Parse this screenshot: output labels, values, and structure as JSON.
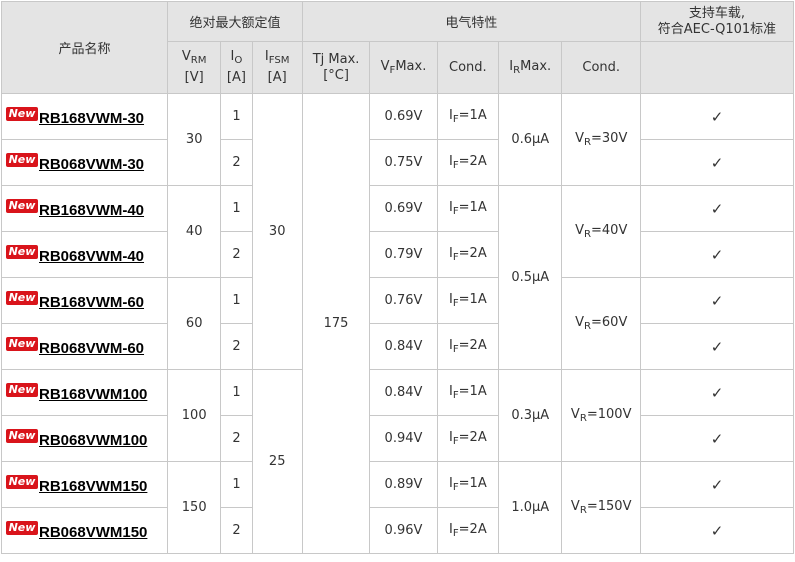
{
  "headers": {
    "product_name": "产品名称",
    "abs_max": "绝对最大额定值",
    "elec": "电气特性",
    "automotive_line1": "支持车载,",
    "automotive_line2": "符合AEC-Q101标准",
    "vrm_main": "V",
    "vrm_sub": "RM",
    "vrm_unit": "[V]",
    "io_main": "I",
    "io_sub": "O",
    "io_unit": "[A]",
    "ifsm_main": "I",
    "ifsm_sub": "FSM",
    "ifsm_unit": "[A]",
    "tj_main": "Tj Max.",
    "tj_unit": "[°C]",
    "vf_main": "V",
    "vf_sub": "F",
    "vf_rest": "Max.",
    "cond1": "Cond.",
    "ir_main": "I",
    "ir_sub": "R",
    "ir_rest": "Max.",
    "cond2": "Cond."
  },
  "badge": "New",
  "check_mark": "✓",
  "rows": [
    {
      "name": "RB168VWM-30",
      "io": "1",
      "vf": "0.69V",
      "cond_main": "I",
      "cond_sub": "F",
      "cond_rest": "=1A"
    },
    {
      "name": "RB068VWM-30",
      "io": "2",
      "vf": "0.75V",
      "cond_main": "I",
      "cond_sub": "F",
      "cond_rest": "=2A"
    },
    {
      "name": "RB168VWM-40",
      "io": "1",
      "vf": "0.69V",
      "cond_main": "I",
      "cond_sub": "F",
      "cond_rest": "=1A"
    },
    {
      "name": "RB068VWM-40",
      "io": "2",
      "vf": "0.79V",
      "cond_main": "I",
      "cond_sub": "F",
      "cond_rest": "=2A"
    },
    {
      "name": "RB168VWM-60",
      "io": "1",
      "vf": "0.76V",
      "cond_main": "I",
      "cond_sub": "F",
      "cond_rest": "=1A"
    },
    {
      "name": "RB068VWM-60",
      "io": "2",
      "vf": "0.84V",
      "cond_main": "I",
      "cond_sub": "F",
      "cond_rest": "=2A"
    },
    {
      "name": "RB168VWM100",
      "io": "1",
      "vf": "0.84V",
      "cond_main": "I",
      "cond_sub": "F",
      "cond_rest": "=1A"
    },
    {
      "name": "RB068VWM100",
      "io": "2",
      "vf": "0.94V",
      "cond_main": "I",
      "cond_sub": "F",
      "cond_rest": "=2A"
    },
    {
      "name": "RB168VWM150",
      "io": "1",
      "vf": "0.89V",
      "cond_main": "I",
      "cond_sub": "F",
      "cond_rest": "=1A"
    },
    {
      "name": "RB068VWM150",
      "io": "2",
      "vf": "0.96V",
      "cond_main": "I",
      "cond_sub": "F",
      "cond_rest": "=2A"
    }
  ],
  "vrm": [
    "30",
    "40",
    "60",
    "100",
    "150"
  ],
  "ifsm": [
    "30",
    "25"
  ],
  "tj": "175",
  "ir": [
    "0.6μA",
    "0.5μA",
    "0.3μA",
    "1.0μA"
  ],
  "vr_cond": [
    {
      "main": "V",
      "sub": "R",
      "rest": "=30V"
    },
    {
      "main": "V",
      "sub": "R",
      "rest": "=40V"
    },
    {
      "main": "V",
      "sub": "R",
      "rest": "=60V"
    },
    {
      "main": "V",
      "sub": "R",
      "rest": "=100V"
    },
    {
      "main": "V",
      "sub": "R",
      "rest": "=150V"
    }
  ]
}
